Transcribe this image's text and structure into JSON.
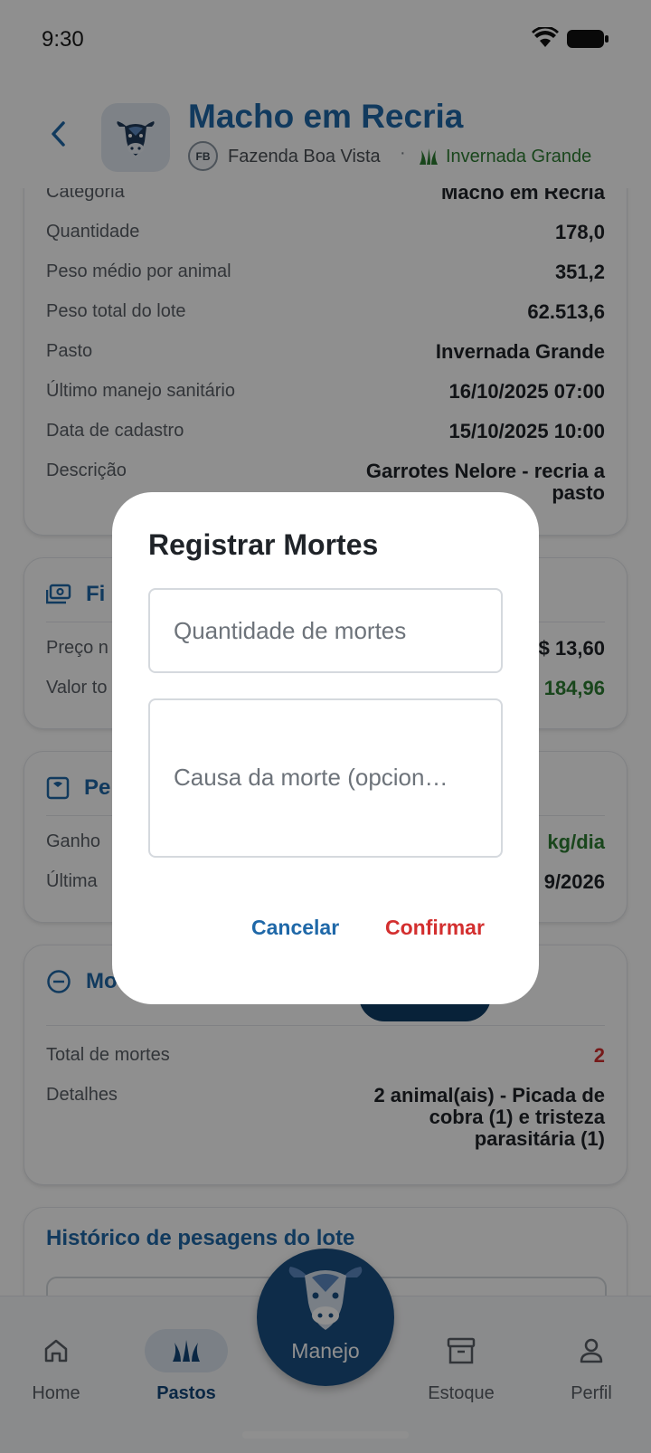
{
  "status_bar": {
    "time": "9:30"
  },
  "header": {
    "title": "Macho em Recria",
    "farm_badge": "FB",
    "farm_name": "Fazenda Boa Vista",
    "separator": "·",
    "pasture_name": "Invernada Grande"
  },
  "details_card": {
    "rows": [
      {
        "label": "Categoria",
        "value": "Macho em Recria"
      },
      {
        "label": "Quantidade",
        "value": "178,0"
      },
      {
        "label": "Peso médio por animal",
        "value": "351,2"
      },
      {
        "label": "Peso total do lote",
        "value": "62.513,6"
      },
      {
        "label": "Pasto",
        "value": "Invernada Grande"
      },
      {
        "label": "Último manejo sanitário",
        "value": "16/10/2025 07:00"
      },
      {
        "label": "Data de cadastro",
        "value": "15/10/2025 10:00"
      },
      {
        "label": "Descrição",
        "value": "Garrotes Nelore - recria a pasto"
      }
    ]
  },
  "finance_card": {
    "title_visible": "Fi",
    "rows": [
      {
        "label": "Preço n",
        "value": "$ 13,60"
      },
      {
        "label": "Valor to",
        "value": "184,96"
      }
    ]
  },
  "weight_card": {
    "title_visible": "Pe",
    "rows": [
      {
        "label": "Ganho",
        "value": "kg/dia"
      },
      {
        "label": "Última",
        "value": "9/2026"
      }
    ]
  },
  "deaths_card": {
    "title_visible": "Mo",
    "rows": [
      {
        "label": "Total de mortes",
        "value": "2"
      },
      {
        "label": "Detalhes",
        "value": "2 animal(ais) - Picada de cobra (1) e tristeza parasitária (1)"
      }
    ]
  },
  "history_card": {
    "title": "Histórico de pesagens do lote"
  },
  "bottom_nav": {
    "items": [
      {
        "label": "Home",
        "icon": "home-icon",
        "active": false
      },
      {
        "label": "Pastos",
        "icon": "pasture-icon",
        "active": true
      },
      {
        "label": "Estoque",
        "icon": "archive-icon",
        "active": false
      },
      {
        "label": "Perfil",
        "icon": "person-icon",
        "active": false
      }
    ],
    "center_button": {
      "label": "Manejo",
      "icon": "cow-icon"
    }
  },
  "dialog": {
    "title": "Registrar Mortes",
    "quantity_field": {
      "placeholder": "Quantidade de mortes",
      "value": ""
    },
    "cause_field": {
      "placeholder": "Causa da morte (opcion…",
      "value": ""
    },
    "cancel_label": "Cancelar",
    "confirm_label": "Confirmar"
  },
  "colors": {
    "primary": "#1f68a8",
    "primary_dark": "#12467a",
    "positive": "#2e7d32",
    "danger": "#d32f2f"
  }
}
